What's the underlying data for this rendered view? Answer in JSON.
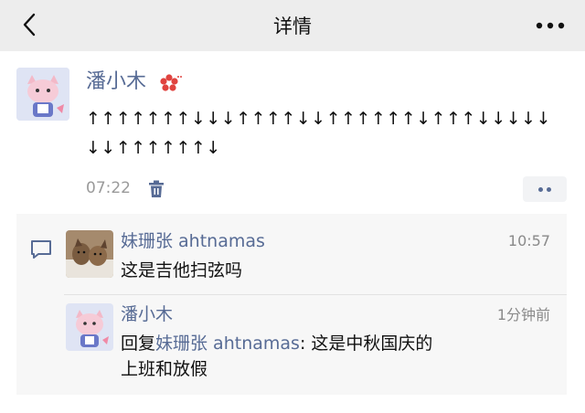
{
  "navbar": {
    "title": "详情",
    "back_icon": "chevron-left-icon",
    "more_icon": "more-dots-icon"
  },
  "post": {
    "author": "潘小木",
    "badge_icon": "flower-badge-icon",
    "content": "↑↑↑↑↑↑↑↓↓↓↑↑↑↑↓↓↑↑↑↑↑↑↓↑↑↑↓↓↓↓↓↓↓↑↑↑↑↑↑↓",
    "time": "07:22",
    "delete_icon": "trash-icon",
    "action_icon": "two-dots-icon"
  },
  "comments": [
    {
      "author": "妹珊张 ahtnamas",
      "time": "10:57",
      "text": "这是吉他扫弦吗"
    },
    {
      "author": "潘小木",
      "time": "1分钟前",
      "reply_prefix": "回复",
      "reply_to": "妹珊张 ahtnamas",
      "reply_sep": ":",
      "text": "这是中秋国庆的上班和放假"
    }
  ],
  "colors": {
    "link": "#576b95",
    "navbar_bg": "#ededed",
    "panel_bg": "#f7f7f7",
    "secondary_text": "#8a8a8a",
    "badge_red": "#e0433f"
  }
}
